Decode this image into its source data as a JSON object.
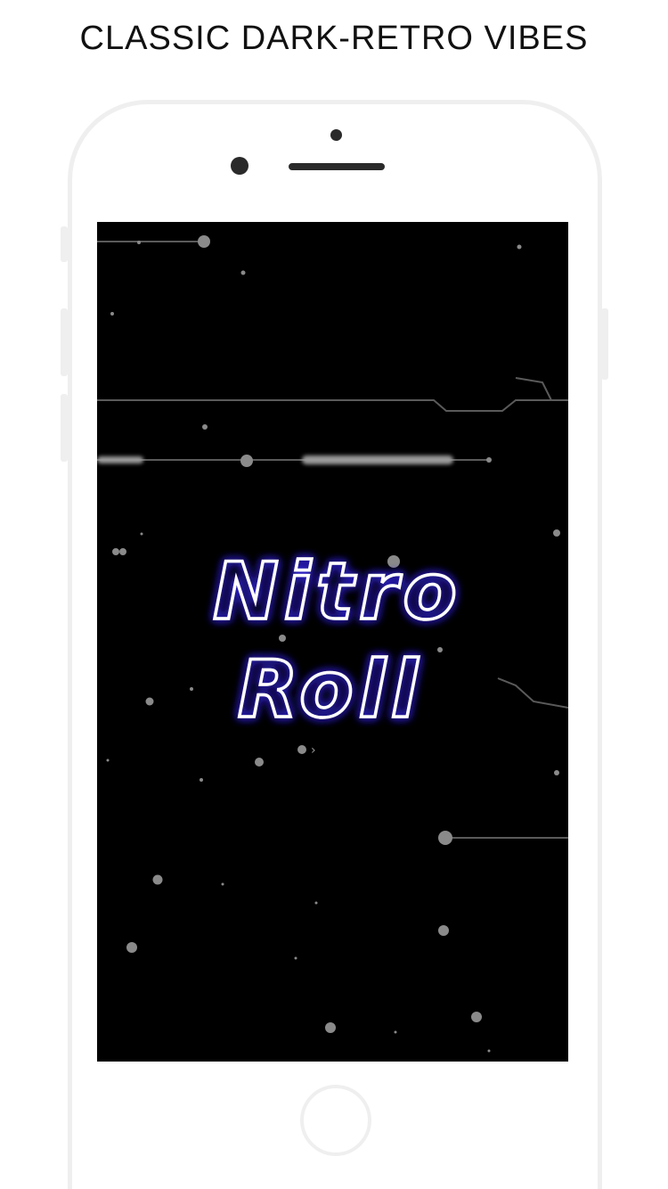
{
  "promo": {
    "headline": "CLASSIC DARK-RETRO VIBES"
  },
  "app": {
    "logo_line1": "Nitro",
    "logo_line2": "Roll"
  },
  "colors": {
    "background": "#ffffff",
    "screen": "#000000",
    "logo_stroke": "#ffffff",
    "logo_glow": "#3b2bff",
    "phone_frame": "#efefef"
  }
}
